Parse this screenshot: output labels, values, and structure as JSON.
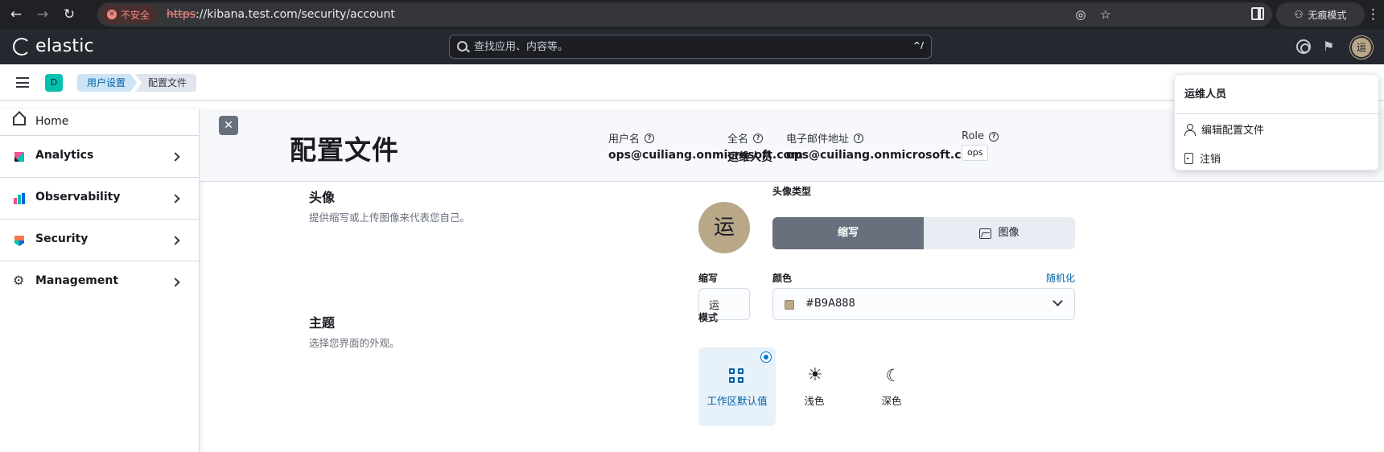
{
  "browser": {
    "security_label": "不安全",
    "url_scheme": "https",
    "url_rest": "://kibana.test.com/security/account",
    "incognito_label": "无痕模式"
  },
  "header": {
    "logo_text": "elastic",
    "search_placeholder": "查找应用、内容等。",
    "search_shortcut": "^/",
    "avatar_initial": "运"
  },
  "breadcrumbs": {
    "space_initial": "D",
    "items": [
      "用户设置",
      "配置文件"
    ]
  },
  "nav": {
    "items": [
      {
        "label": "Home",
        "icon": "home-icon"
      },
      {
        "label": "Analytics",
        "icon": "analytics-logo-icon"
      },
      {
        "label": "Observability",
        "icon": "observability-logo-icon"
      },
      {
        "label": "Security",
        "icon": "security-logo-icon"
      },
      {
        "label": "Management",
        "icon": "gear-icon"
      }
    ]
  },
  "page": {
    "title": "配置文件",
    "meta": {
      "username_label": "用户名",
      "username": "ops@cuiliang.onmicrosoft.com",
      "fullname_label": "全名",
      "fullname": "运维人员",
      "email_label": "电子邮件地址",
      "email": "ops@cuiliang.onmicrosoft.com",
      "role_label": "Role",
      "role": "ops"
    },
    "avatar_section": {
      "title": "头像",
      "desc": "提供缩写或上传图像来代表您自己。",
      "avatar_initial": "运",
      "type_label": "头像类型",
      "type_initials": "缩写",
      "type_image": "图像",
      "initials_label": "缩写",
      "initials_value": "运",
      "color_label": "颜色",
      "randomize": "随机化",
      "color_value": "#B9A888"
    },
    "theme_section": {
      "title": "主题",
      "desc": "选择您界面的外观。",
      "mode_label": "模式",
      "modes": [
        "工作区默认值",
        "浅色",
        "深色"
      ],
      "selected_mode": "工作区默认值"
    }
  },
  "popover": {
    "user_name": "运维人员",
    "items": [
      "编辑配置文件",
      "注销"
    ]
  },
  "colors": {
    "avatar": "#B9A888",
    "accent": "#0061A6",
    "header_bg": "#25282F"
  }
}
